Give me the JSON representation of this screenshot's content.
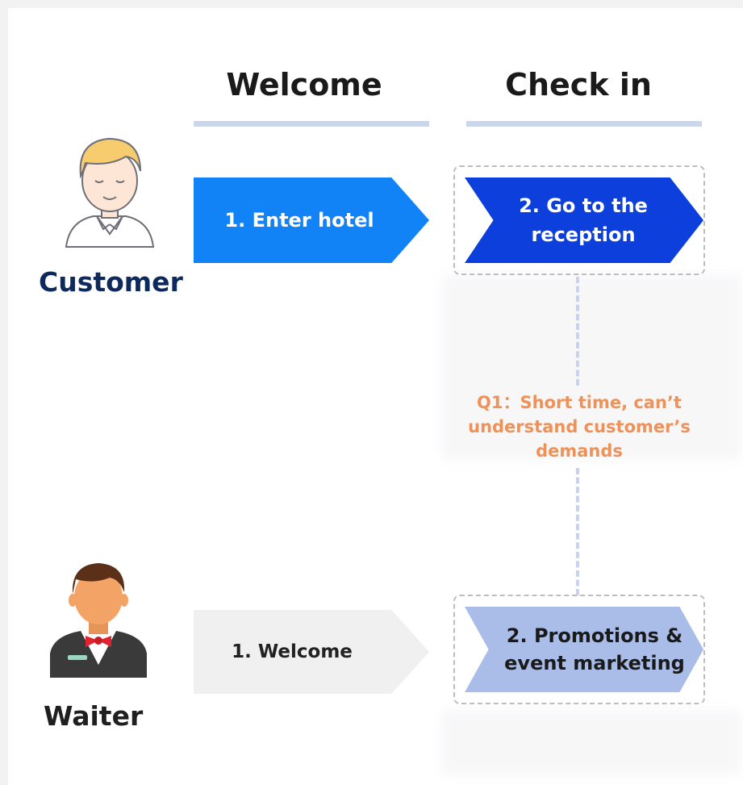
{
  "phases": [
    {
      "title": "Welcome"
    },
    {
      "title": "Check in"
    }
  ],
  "roles": {
    "customer": "Customer",
    "waiter": "Waiter"
  },
  "steps": {
    "customer_welcome": "1.  Enter hotel",
    "customer_checkin": "2. Go to the reception",
    "waiter_welcome": "1.  Welcome",
    "waiter_checkin": "2. Promotions & event marketing"
  },
  "issue": {
    "text": "Q1：Short time, can’t understand customer’s demands"
  },
  "colors": {
    "customer_step_welcome": "#1283f6",
    "customer_step_checkin": "#0c3fdc",
    "waiter_step_welcome": "#f0f0f0",
    "waiter_step_checkin": "#a9bde8",
    "role_customer": "#0e2a5c",
    "phase_bar": "#cbd6ea",
    "issue_text": "#ee9259",
    "connector": "#c8d4ee"
  },
  "icons": {
    "customer": "customer-avatar-icon",
    "waiter": "waiter-avatar-icon"
  }
}
